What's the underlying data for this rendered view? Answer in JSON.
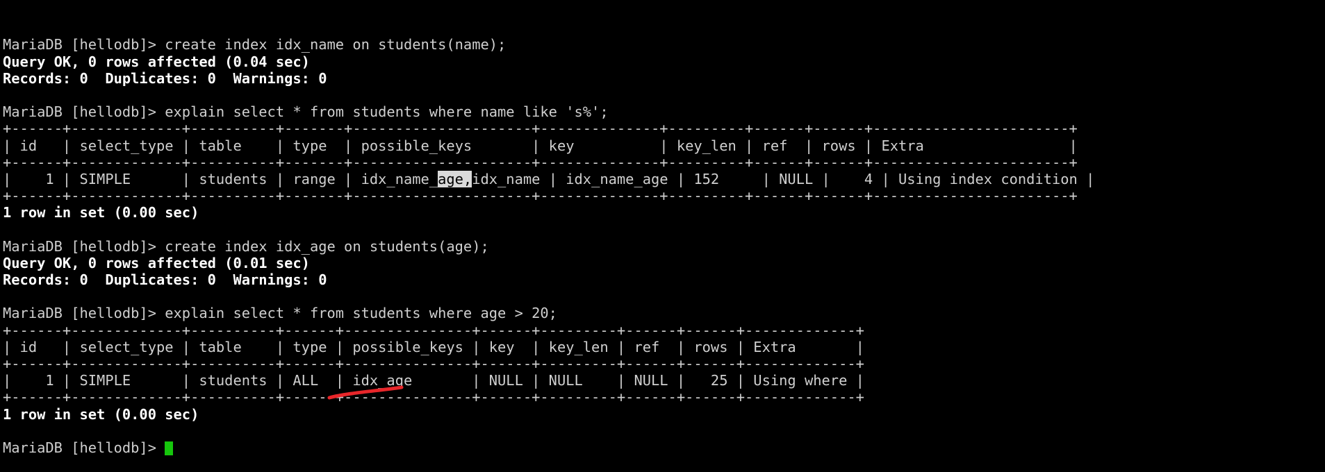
{
  "terminal": {
    "app": "MariaDB client",
    "prompt": "MariaDB [hellodb]> ",
    "database": "hellodb",
    "colors": {
      "background": "#000000",
      "foreground": "#cfcfcf",
      "bold_foreground": "#ffffff",
      "cursor": "#16c60c",
      "selection_background": "#d9d9d9",
      "selection_foreground": "#000000",
      "annotation_red": "#e8262a"
    },
    "lines": [
      {
        "id": "l01",
        "text": "MariaDB [hellodb]> create index idx_name on students(name);",
        "bold": false
      },
      {
        "id": "l02",
        "text": "Query OK, 0 rows affected (0.04 sec)",
        "bold": true
      },
      {
        "id": "l03",
        "text": "Records: 0  Duplicates: 0  Warnings: 0",
        "bold": true
      },
      {
        "id": "l04",
        "text": "",
        "bold": false
      },
      {
        "id": "l05",
        "text": "MariaDB [hellodb]> explain select * from students where name like 's%';",
        "bold": false
      },
      {
        "id": "l06",
        "text": "+------+-------------+----------+-------+---------------------+--------------+---------+------+------+-----------------------+",
        "bold": false
      },
      {
        "id": "l07",
        "text": "| id   | select_type | table    | type  | possible_keys       | key          | key_len | ref  | rows | Extra                 |",
        "bold": false
      },
      {
        "id": "l08",
        "text": "+------+-------------+----------+-------+---------------------+--------------+---------+------+------+-----------------------+",
        "bold": false
      },
      {
        "id": "l09",
        "text": "",
        "bold": false,
        "segments": [
          {
            "text": "|    1 | SIMPLE      | students | range | idx_name_"
          },
          {
            "text": "age,",
            "selected": true
          },
          {
            "text": "idx_name | idx_name_age | 152     | NULL |    4 | Using index condition |"
          }
        ]
      },
      {
        "id": "l10",
        "text": "+------+-------------+----------+-------+---------------------+--------------+---------+------+------+-----------------------+",
        "bold": false
      },
      {
        "id": "l11",
        "text": "1 row in set (0.00 sec)",
        "bold": true
      },
      {
        "id": "l12",
        "text": "",
        "bold": false
      },
      {
        "id": "l13",
        "text": "MariaDB [hellodb]> create index idx_age on students(age);",
        "bold": false
      },
      {
        "id": "l14",
        "text": "Query OK, 0 rows affected (0.01 sec)",
        "bold": true
      },
      {
        "id": "l15",
        "text": "Records: 0  Duplicates: 0  Warnings: 0",
        "bold": true
      },
      {
        "id": "l16",
        "text": "",
        "bold": false
      },
      {
        "id": "l17",
        "text": "MariaDB [hellodb]> explain select * from students where age > 20;",
        "bold": false
      },
      {
        "id": "l18",
        "text": "+------+-------------+----------+------+---------------+------+---------+------+------+-------------+",
        "bold": false
      },
      {
        "id": "l19",
        "text": "| id   | select_type | table    | type | possible_keys | key  | key_len | ref  | rows | Extra       |",
        "bold": false
      },
      {
        "id": "l20",
        "text": "+------+-------------+----------+------+---------------+------+---------+------+------+-------------+",
        "bold": false
      },
      {
        "id": "l21",
        "text": "|    1 | SIMPLE      | students | ALL  | idx_age       | NULL | NULL    | NULL |   25 | Using where |",
        "bold": false
      },
      {
        "id": "l22",
        "text": "+------+-------------+----------+------+---------------+------+---------+------+------+-------------+",
        "bold": false
      },
      {
        "id": "l23",
        "text": "1 row in set (0.00 sec)",
        "bold": true
      },
      {
        "id": "l24",
        "text": "",
        "bold": false
      },
      {
        "id": "l25",
        "text": "MariaDB [hellodb]> ",
        "bold": false,
        "cursor": true
      }
    ]
  },
  "commands": [
    {
      "sql": "create index idx_name on students(name);",
      "result_status": "Query OK, 0 rows affected (0.04 sec)",
      "result_detail": "Records: 0  Duplicates: 0  Warnings: 0"
    },
    {
      "sql": "explain select * from students where name like 's%';",
      "footer": "1 row in set (0.00 sec)"
    },
    {
      "sql": "create index idx_age on students(age);",
      "result_status": "Query OK, 0 rows affected (0.01 sec)",
      "result_detail": "Records: 0  Duplicates: 0  Warnings: 0"
    },
    {
      "sql": "explain select * from students where age > 20;",
      "footer": "1 row in set (0.00 sec)"
    }
  ],
  "explain_tables": [
    {
      "name": "explain-name-like",
      "columns": [
        "id",
        "select_type",
        "table",
        "type",
        "possible_keys",
        "key",
        "key_len",
        "ref",
        "rows",
        "Extra"
      ],
      "rows": [
        [
          "1",
          "SIMPLE",
          "students",
          "range",
          "idx_name_age,idx_name",
          "idx_name_age",
          "152",
          "NULL",
          "4",
          "Using index condition"
        ]
      ],
      "selection": "age,"
    },
    {
      "name": "explain-age-gt-20",
      "columns": [
        "id",
        "select_type",
        "table",
        "type",
        "possible_keys",
        "key",
        "key_len",
        "ref",
        "rows",
        "Extra"
      ],
      "rows": [
        [
          "1",
          "SIMPLE",
          "students",
          "ALL",
          "idx_age",
          "NULL",
          "NULL",
          "NULL",
          "25",
          "Using where"
        ]
      ],
      "annotation": "red underline under idx_age in possible_keys"
    }
  ]
}
